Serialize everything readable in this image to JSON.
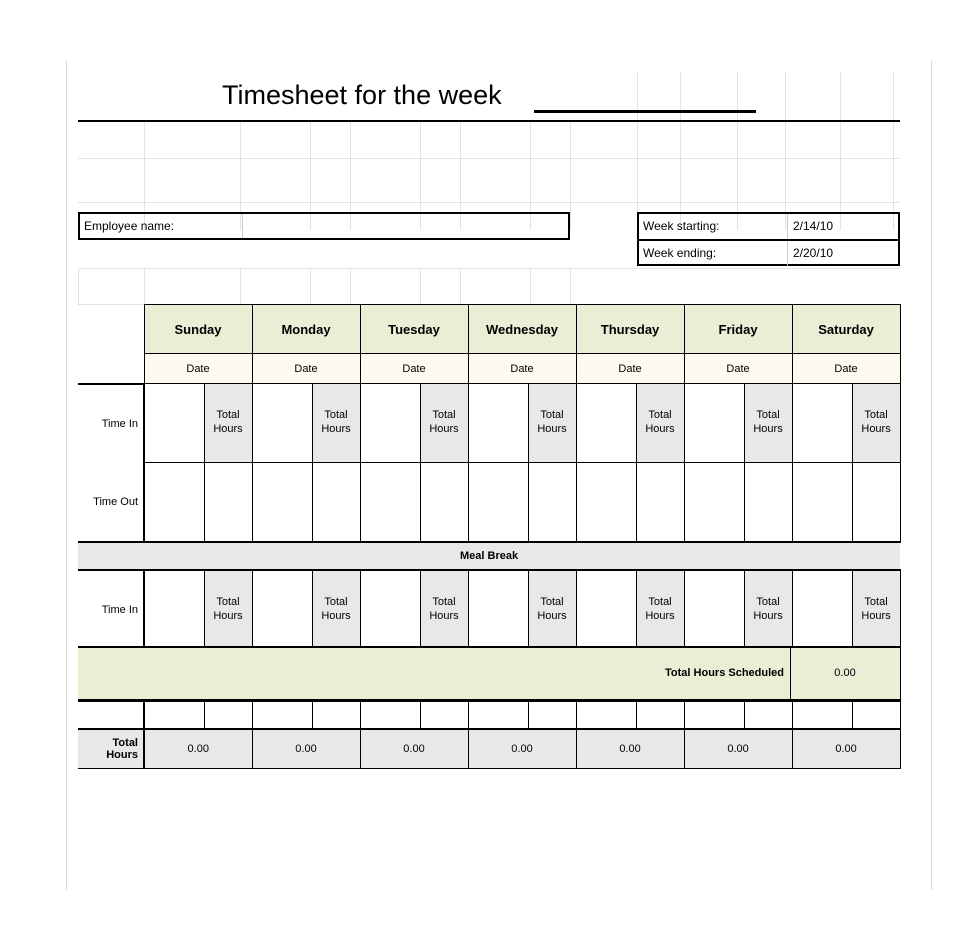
{
  "title": {
    "text": "Timesheet for the week",
    "blank_line": ""
  },
  "employee": {
    "label": "Employee name:",
    "value": ""
  },
  "week": {
    "starting_label": "Week starting:",
    "starting_value": "2/14/10",
    "ending_label": "Week ending:",
    "ending_value": "2/20/10"
  },
  "days": [
    "Sunday",
    "Monday",
    "Tuesday",
    "Wednesday",
    "Thursday",
    "Friday",
    "Saturday"
  ],
  "date_label": "Date",
  "rows": {
    "time_in": "Time In",
    "time_out": "Time Out",
    "total_hours_col": "Total Hours",
    "meal_break": "Meal Break",
    "total_hours_row": "Total Hours"
  },
  "totals": {
    "per_day": [
      "0.00",
      "0.00",
      "0.00",
      "0.00",
      "0.00",
      "0.00",
      "0.00"
    ],
    "scheduled_label": "Total Hours Scheduled",
    "scheduled_value": "0.00"
  },
  "colors": {
    "header_green": "#e9eed4",
    "date_cream": "#fdfaf0",
    "cell_gray": "#e8e8e8",
    "border_black": "#000000",
    "grid_faint": "#e2e2e2"
  }
}
